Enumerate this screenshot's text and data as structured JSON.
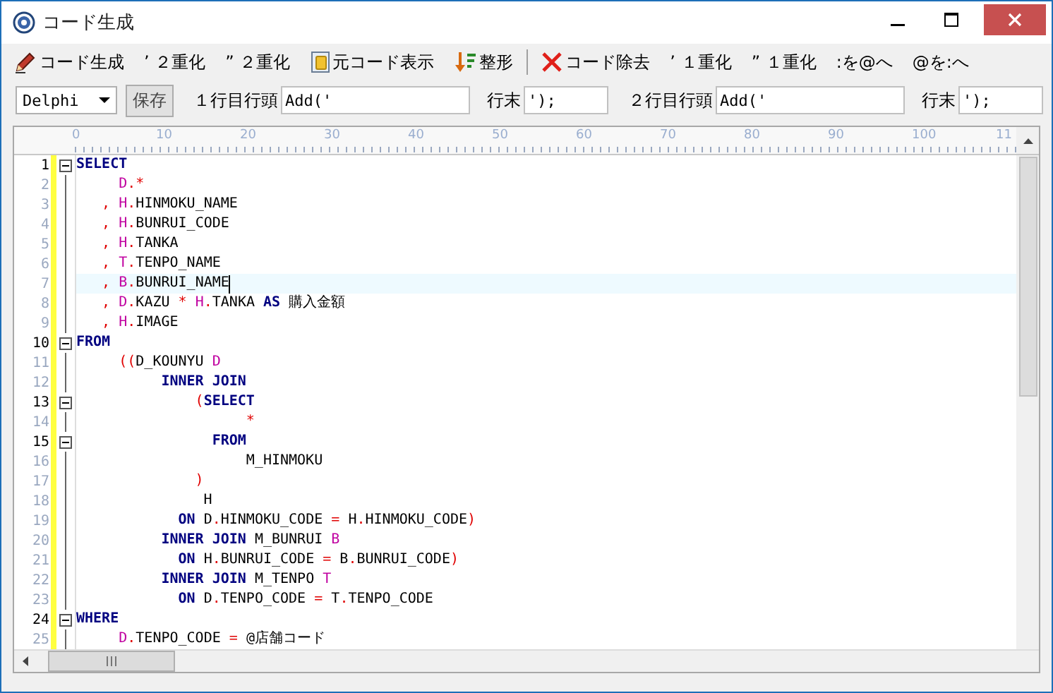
{
  "window": {
    "title": "コード生成"
  },
  "toolbar": [
    {
      "kind": "button",
      "label": "コード生成"
    },
    {
      "kind": "button",
      "label": "’ ２重化"
    },
    {
      "kind": "button",
      "label": "” ２重化"
    },
    {
      "kind": "button",
      "label": "元コード表示"
    },
    {
      "kind": "button",
      "label": "整形"
    },
    {
      "kind": "separator"
    },
    {
      "kind": "button",
      "label": "コード除去"
    },
    {
      "kind": "button",
      "label": "’ １重化"
    },
    {
      "kind": "button",
      "label": "” １重化"
    },
    {
      "kind": "button",
      "label": ":を@へ"
    },
    {
      "kind": "button",
      "label": "@を:へ"
    }
  ],
  "options": {
    "language": "Delphi",
    "save_button": "保存",
    "fields": [
      {
        "label": "１行目行頭",
        "value": "Add('"
      },
      {
        "label": "行末",
        "value": "');"
      },
      {
        "label": "２行目行頭",
        "value": "Add('"
      },
      {
        "label": "行末",
        "value": "');"
      }
    ]
  },
  "ruler": [
    "0",
    "10",
    "20",
    "30",
    "40",
    "50",
    "60",
    "70",
    "80",
    "90",
    "100",
    "11"
  ],
  "code_lines": [
    {
      "number": "1",
      "fold": true,
      "current": false,
      "tokens": [
        {
          "kind": "keyword",
          "text": "SELECT"
        }
      ]
    },
    {
      "number": "2",
      "fold": false,
      "current": false,
      "tokens": [
        {
          "kind": "alias",
          "text": "     D"
        },
        {
          "kind": "operator",
          "text": ".*"
        }
      ]
    },
    {
      "number": "3",
      "fold": false,
      "current": false,
      "tokens": [
        {
          "kind": "operator",
          "text": "   , "
        },
        {
          "kind": "alias",
          "text": "H"
        },
        {
          "kind": "operator",
          "text": "."
        },
        {
          "kind": "identifier",
          "text": "HINMOKU_NAME"
        }
      ]
    },
    {
      "number": "4",
      "fold": false,
      "current": false,
      "tokens": [
        {
          "kind": "operator",
          "text": "   , "
        },
        {
          "kind": "alias",
          "text": "H"
        },
        {
          "kind": "operator",
          "text": "."
        },
        {
          "kind": "identifier",
          "text": "BUNRUI_CODE"
        }
      ]
    },
    {
      "number": "5",
      "fold": false,
      "current": false,
      "tokens": [
        {
          "kind": "operator",
          "text": "   , "
        },
        {
          "kind": "alias",
          "text": "H"
        },
        {
          "kind": "operator",
          "text": "."
        },
        {
          "kind": "identifier",
          "text": "TANKA"
        }
      ]
    },
    {
      "number": "6",
      "fold": false,
      "current": false,
      "tokens": [
        {
          "kind": "operator",
          "text": "   , "
        },
        {
          "kind": "alias",
          "text": "T"
        },
        {
          "kind": "operator",
          "text": "."
        },
        {
          "kind": "identifier",
          "text": "TENPO_NAME"
        }
      ]
    },
    {
      "number": "7",
      "fold": false,
      "current": true,
      "tokens": [
        {
          "kind": "operator",
          "text": "   , "
        },
        {
          "kind": "alias",
          "text": "B"
        },
        {
          "kind": "operator",
          "text": "."
        },
        {
          "kind": "identifier",
          "text": "BUNRUI_NAME"
        }
      ]
    },
    {
      "number": "8",
      "fold": false,
      "current": false,
      "tokens": [
        {
          "kind": "operator",
          "text": "   , "
        },
        {
          "kind": "alias",
          "text": "D"
        },
        {
          "kind": "operator",
          "text": "."
        },
        {
          "kind": "identifier",
          "text": "KAZU "
        },
        {
          "kind": "operator",
          "text": "* "
        },
        {
          "kind": "alias",
          "text": "H"
        },
        {
          "kind": "operator",
          "text": "."
        },
        {
          "kind": "identifier",
          "text": "TANKA "
        },
        {
          "kind": "keyword",
          "text": "AS"
        },
        {
          "kind": "identifier",
          "text": " 購入金額"
        }
      ]
    },
    {
      "number": "9",
      "fold": false,
      "current": false,
      "tokens": [
        {
          "kind": "operator",
          "text": "   , "
        },
        {
          "kind": "alias",
          "text": "H"
        },
        {
          "kind": "operator",
          "text": "."
        },
        {
          "kind": "identifier",
          "text": "IMAGE"
        }
      ]
    },
    {
      "number": "10",
      "fold": true,
      "current": false,
      "tokens": [
        {
          "kind": "keyword",
          "text": "FROM"
        }
      ]
    },
    {
      "number": "11",
      "fold": false,
      "current": false,
      "tokens": [
        {
          "kind": "operator",
          "text": "     (("
        },
        {
          "kind": "identifier",
          "text": "D_KOUNYU "
        },
        {
          "kind": "alias",
          "text": "D"
        }
      ]
    },
    {
      "number": "12",
      "fold": false,
      "current": false,
      "tokens": [
        {
          "kind": "keyword",
          "text": "          INNER JOIN"
        }
      ]
    },
    {
      "number": "13",
      "fold": true,
      "current": false,
      "tokens": [
        {
          "kind": "operator",
          "text": "              ("
        },
        {
          "kind": "keyword",
          "text": "SELECT"
        }
      ]
    },
    {
      "number": "14",
      "fold": false,
      "current": false,
      "tokens": [
        {
          "kind": "operator",
          "text": "                    *"
        }
      ]
    },
    {
      "number": "15",
      "fold": true,
      "current": false,
      "tokens": [
        {
          "kind": "keyword",
          "text": "                FROM"
        }
      ]
    },
    {
      "number": "16",
      "fold": false,
      "current": false,
      "tokens": [
        {
          "kind": "identifier",
          "text": "                    M_HINMOKU"
        }
      ]
    },
    {
      "number": "17",
      "fold": false,
      "current": false,
      "tokens": [
        {
          "kind": "operator",
          "text": "              )"
        }
      ]
    },
    {
      "number": "18",
      "fold": false,
      "current": false,
      "tokens": [
        {
          "kind": "identifier",
          "text": "               H"
        }
      ]
    },
    {
      "number": "19",
      "fold": false,
      "current": false,
      "tokens": [
        {
          "kind": "keyword",
          "text": "            ON"
        },
        {
          "kind": "identifier",
          "text": " D"
        },
        {
          "kind": "operator",
          "text": "."
        },
        {
          "kind": "identifier",
          "text": "HINMOKU_CODE "
        },
        {
          "kind": "operator",
          "text": "="
        },
        {
          "kind": "identifier",
          "text": " H"
        },
        {
          "kind": "operator",
          "text": "."
        },
        {
          "kind": "identifier",
          "text": "HINMOKU_CODE"
        },
        {
          "kind": "operator",
          "text": ")"
        }
      ]
    },
    {
      "number": "20",
      "fold": false,
      "current": false,
      "tokens": [
        {
          "kind": "keyword",
          "text": "          INNER JOIN"
        },
        {
          "kind": "identifier",
          "text": " M_BUNRUI "
        },
        {
          "kind": "alias",
          "text": "B"
        }
      ]
    },
    {
      "number": "21",
      "fold": false,
      "current": false,
      "tokens": [
        {
          "kind": "keyword",
          "text": "            ON"
        },
        {
          "kind": "identifier",
          "text": " H"
        },
        {
          "kind": "operator",
          "text": "."
        },
        {
          "kind": "identifier",
          "text": "BUNRUI_CODE "
        },
        {
          "kind": "operator",
          "text": "="
        },
        {
          "kind": "identifier",
          "text": " B"
        },
        {
          "kind": "operator",
          "text": "."
        },
        {
          "kind": "identifier",
          "text": "BUNRUI_CODE"
        },
        {
          "kind": "operator",
          "text": ")"
        }
      ]
    },
    {
      "number": "22",
      "fold": false,
      "current": false,
      "tokens": [
        {
          "kind": "keyword",
          "text": "          INNER JOIN"
        },
        {
          "kind": "identifier",
          "text": " M_TENPO "
        },
        {
          "kind": "alias",
          "text": "T"
        }
      ]
    },
    {
      "number": "23",
      "fold": false,
      "current": false,
      "tokens": [
        {
          "kind": "keyword",
          "text": "            ON"
        },
        {
          "kind": "identifier",
          "text": " D"
        },
        {
          "kind": "operator",
          "text": "."
        },
        {
          "kind": "identifier",
          "text": "TENPO_CODE "
        },
        {
          "kind": "operator",
          "text": "="
        },
        {
          "kind": "identifier",
          "text": " T"
        },
        {
          "kind": "operator",
          "text": "."
        },
        {
          "kind": "identifier",
          "text": "TENPO_CODE"
        }
      ]
    },
    {
      "number": "24",
      "fold": true,
      "current": false,
      "tokens": [
        {
          "kind": "keyword",
          "text": "WHERE"
        }
      ]
    },
    {
      "number": "25",
      "fold": false,
      "current": false,
      "tokens": [
        {
          "kind": "alias",
          "text": "     D"
        },
        {
          "kind": "operator",
          "text": "."
        },
        {
          "kind": "identifier",
          "text": "TENPO_CODE "
        },
        {
          "kind": "operator",
          "text": "="
        },
        {
          "kind": "identifier",
          "text": " @店舗コード"
        }
      ]
    }
  ]
}
